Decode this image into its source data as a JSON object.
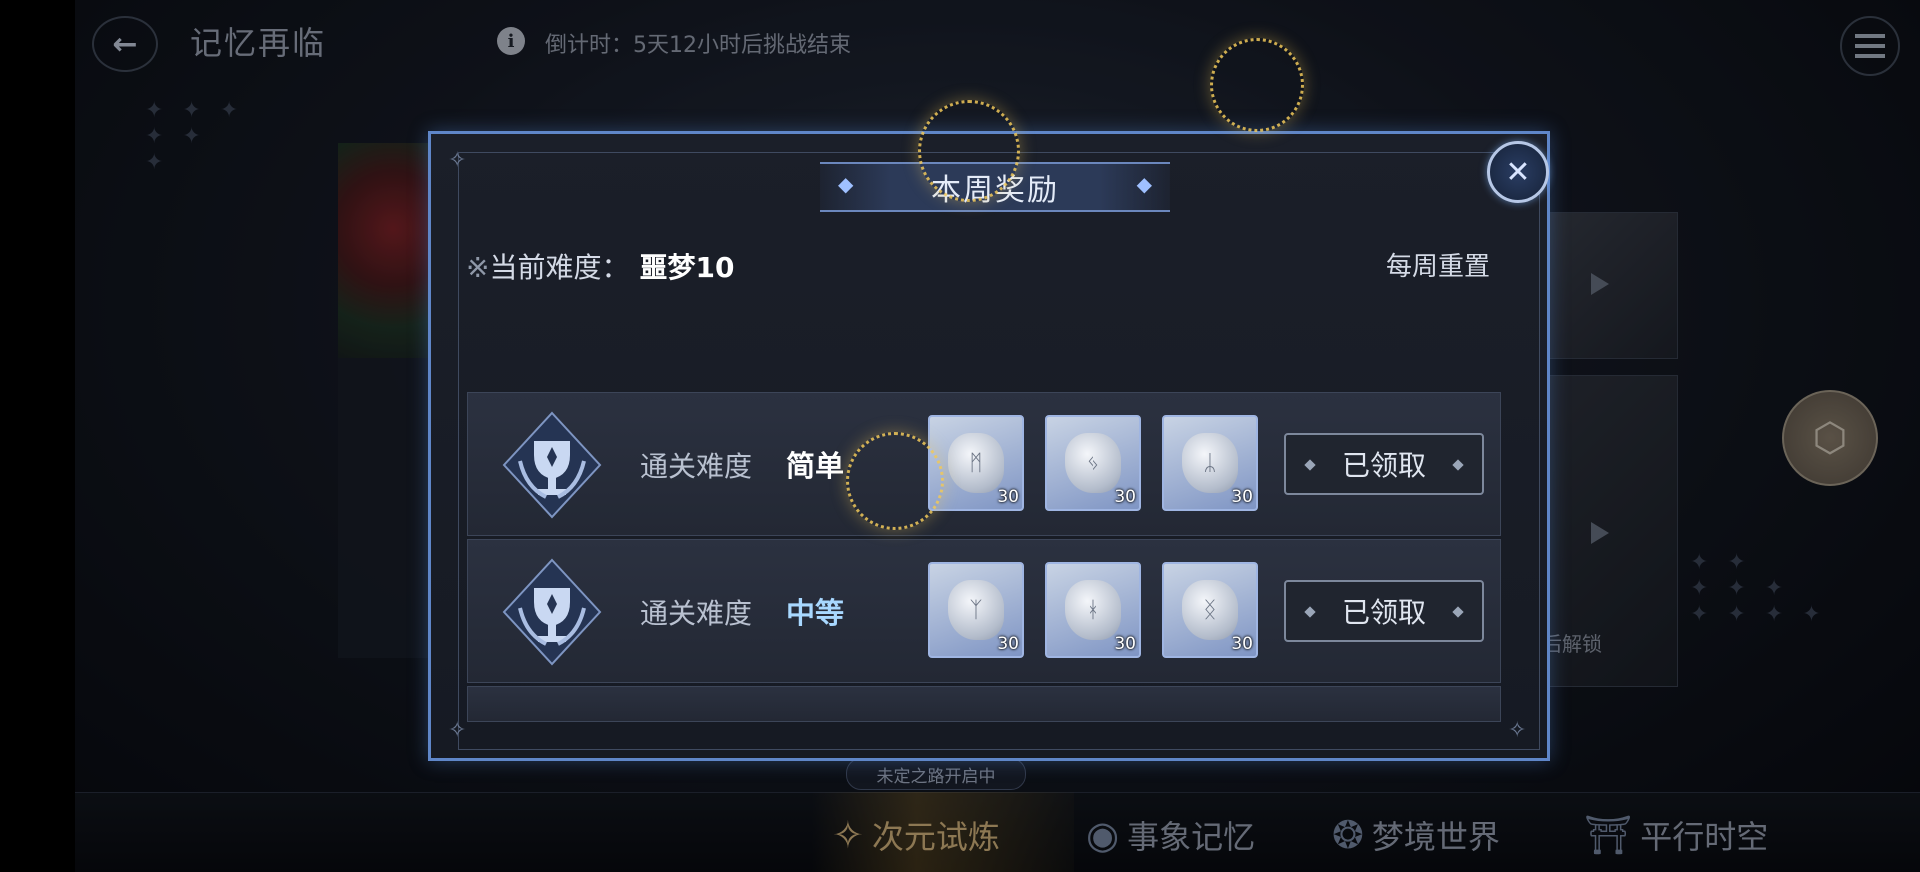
{
  "header": {
    "back_label": "←",
    "title": "记忆再临",
    "info_icon": "i",
    "countdown": "倒计时：5天12小时后挑战结束"
  },
  "background": {
    "unlock_label": "后解锁",
    "route_pill": "未定之路开启中"
  },
  "nav": {
    "tabs": [
      {
        "label": "次元试炼",
        "icon": "star-compass-icon",
        "active": true
      },
      {
        "label": "事象记忆",
        "icon": "vortex-icon",
        "active": false
      },
      {
        "label": "梦境世界",
        "icon": "mandala-icon",
        "active": false
      },
      {
        "label": "平行时空",
        "icon": "gate-icon",
        "active": false
      }
    ]
  },
  "modal": {
    "title": "本周奖励",
    "close": "✕",
    "difficulty": {
      "mark": "※",
      "label": "当前难度：",
      "value": "噩梦10"
    },
    "weekly_reset": "每周重置",
    "rows": [
      {
        "label": "通关难度",
        "difficulty": "简单",
        "items": [
          {
            "glyph": "ᛗ",
            "qty": "30"
          },
          {
            "glyph": "ᛃ",
            "qty": "30"
          },
          {
            "glyph": "ᛦ",
            "qty": "30"
          }
        ],
        "status": "已领取"
      },
      {
        "label": "通关难度",
        "difficulty": "中等",
        "items": [
          {
            "glyph": "ᛉ",
            "qty": "30"
          },
          {
            "glyph": "ᚼ",
            "qty": "30"
          },
          {
            "glyph": "ᛝ",
            "qty": "30"
          }
        ],
        "status": "已领取"
      }
    ]
  },
  "colors": {
    "modal_border": "#5f86c8",
    "active_tab": "#d9b880",
    "medium_difficulty": "#a8d8ff"
  }
}
